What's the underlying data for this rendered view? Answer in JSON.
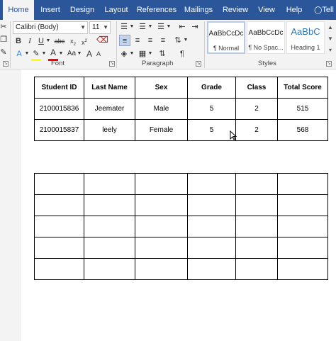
{
  "tabs": [
    "Home",
    "Insert",
    "Design",
    "Layout",
    "References",
    "Mailings",
    "Review",
    "View",
    "Help",
    "Tell"
  ],
  "font": {
    "name": "Calibri (Body)",
    "size": "11"
  },
  "groups": {
    "font": "Font",
    "paragraph": "Paragraph",
    "styles": "Styles"
  },
  "styles": [
    {
      "sample": "AaBbCcDc",
      "name": "¶ Normal"
    },
    {
      "sample": "AaBbCcDc",
      "name": "¶ No Spac..."
    },
    {
      "sample": "AaBbC",
      "name": "Heading 1"
    }
  ],
  "table1": {
    "headers": [
      "Student ID",
      "Last Name",
      "Sex",
      "Grade",
      "Class",
      "Total Score"
    ],
    "rows": [
      [
        "2100015836",
        "Jeemater",
        "Male",
        "5",
        "2",
        "515"
      ],
      [
        "2100015837",
        "leely",
        "Female",
        "5",
        "2",
        "568"
      ]
    ]
  },
  "table2": {
    "rows": 5,
    "cols": 6
  },
  "colors": {
    "brand": "#2b579a",
    "highlight": "#ffff00",
    "font_color": "#ff0000"
  }
}
